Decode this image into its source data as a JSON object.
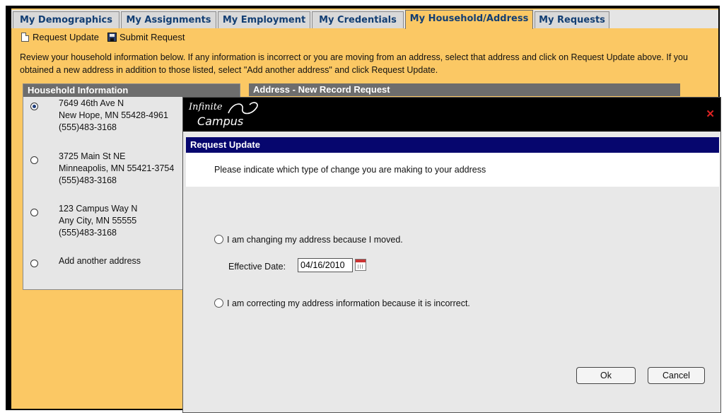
{
  "tabs": [
    {
      "label": "My Demographics",
      "active": false
    },
    {
      "label": "My Assignments",
      "active": false
    },
    {
      "label": "My Employment",
      "active": false
    },
    {
      "label": "My Credentials",
      "active": false
    },
    {
      "label": "My Household/Address",
      "active": true
    },
    {
      "label": "My Requests",
      "active": false
    }
  ],
  "toolbar": {
    "request_update": "Request Update",
    "submit_request": "Submit Request"
  },
  "instructions": "Review your household information below. If any information is incorrect or you are moving from an address, select that address and click on Request Update above. If you obtained a new address in addition to those listed, select \"Add another address\" and click Request Update.",
  "household": {
    "header": "Household Information",
    "addresses": [
      {
        "line1": "7649 46th Ave N",
        "line2": "New Hope, MN 55428-4961",
        "phone": "(555)483-3168",
        "selected": true
      },
      {
        "line1": "3725 Main St NE",
        "line2": "Minneapolis, MN 55421-3754",
        "phone": "(555)483-3168",
        "selected": false
      },
      {
        "line1": "123 Campus Way N",
        "line2": "Any City, MN 55555",
        "phone": "(555)483-3168",
        "selected": false
      }
    ],
    "add_another": "Add another address"
  },
  "address_panel": {
    "header": "Address - New Record Request"
  },
  "modal": {
    "brand_line1": "Infinite",
    "brand_line2": "Campus",
    "close_glyph": "✕",
    "title": "Request Update",
    "description": "Please indicate which type of change you are making to your address",
    "option_moved": "I am changing my address because I moved.",
    "effective_date_label": "Effective Date:",
    "effective_date_value": "04/16/2010",
    "option_correcting": "I am correcting my address information because it is incorrect.",
    "ok_label": "Ok",
    "cancel_label": "Cancel"
  },
  "colors": {
    "app_background": "#fbc864",
    "panel_header": "#6d6d6d",
    "modal_title_bar": "#06066e",
    "close_icon": "#dd2222"
  },
  "icons": {
    "request_update": "document-icon",
    "submit_request": "save-disk-icon",
    "date_picker": "calendar-icon",
    "close": "close-icon"
  }
}
